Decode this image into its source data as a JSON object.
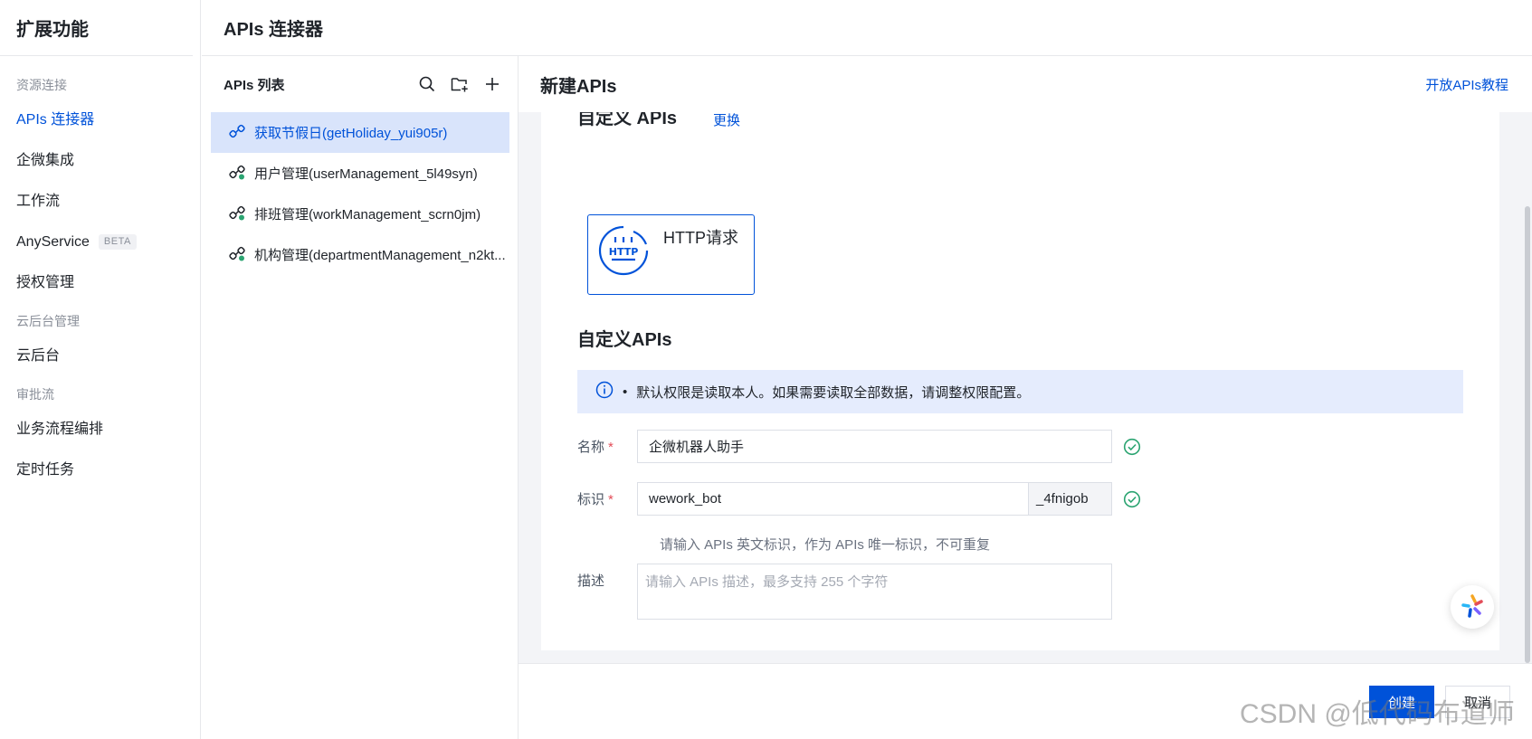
{
  "nav": {
    "brand": "扩展功能",
    "groups": [
      {
        "label": "资源连接"
      },
      {
        "label": "云后台管理"
      },
      {
        "label": "审批流"
      }
    ],
    "items": [
      {
        "label": "APIs 连接器"
      },
      {
        "label": "企微集成"
      },
      {
        "label": "工作流"
      },
      {
        "label": "AnyService",
        "badge": "BETA"
      },
      {
        "label": "授权管理"
      },
      {
        "label": "云后台"
      },
      {
        "label": "业务流程编排"
      },
      {
        "label": "定时任务"
      }
    ]
  },
  "header": {
    "title": "APIs 连接器"
  },
  "api_list": {
    "title": "APIs 列表",
    "items": [
      {
        "label": "获取节假日(getHoliday_yui905r)"
      },
      {
        "label": "用户管理(userManagement_5l49syn)"
      },
      {
        "label": "排班管理(workManagement_scrn0jm)"
      },
      {
        "label": "机构管理(departmentManagement_n2kt..."
      }
    ]
  },
  "main": {
    "title": "新建APIs",
    "tutorial_link": "开放APIs教程",
    "type_section": {
      "title": "自定义 APIs",
      "change_link": "更换",
      "card_label": "HTTP请求",
      "icon_text": "HTTP"
    },
    "form_section": {
      "title": "自定义APIs",
      "notice": "默认权限是读取本人。如果需要读取全部数据，请调整权限配置。",
      "name_label": "名称",
      "name_value": "企微机器人助手",
      "id_label": "标识",
      "id_value": "wework_bot",
      "id_suffix": "_4fnigob",
      "id_hint": "请输入 APIs 英文标识，作为 APIs 唯一标识，不可重复",
      "desc_label": "描述",
      "desc_placeholder": "请输入 APIs 描述，最多支持 255 个字符",
      "required_mark": "*"
    }
  },
  "actions": {
    "create": "创建",
    "cancel": "取消"
  },
  "watermark": "CSDN @低代码布道师",
  "colors": {
    "primary": "#0052d9",
    "success": "#2ba471",
    "danger": "#e34d59"
  }
}
